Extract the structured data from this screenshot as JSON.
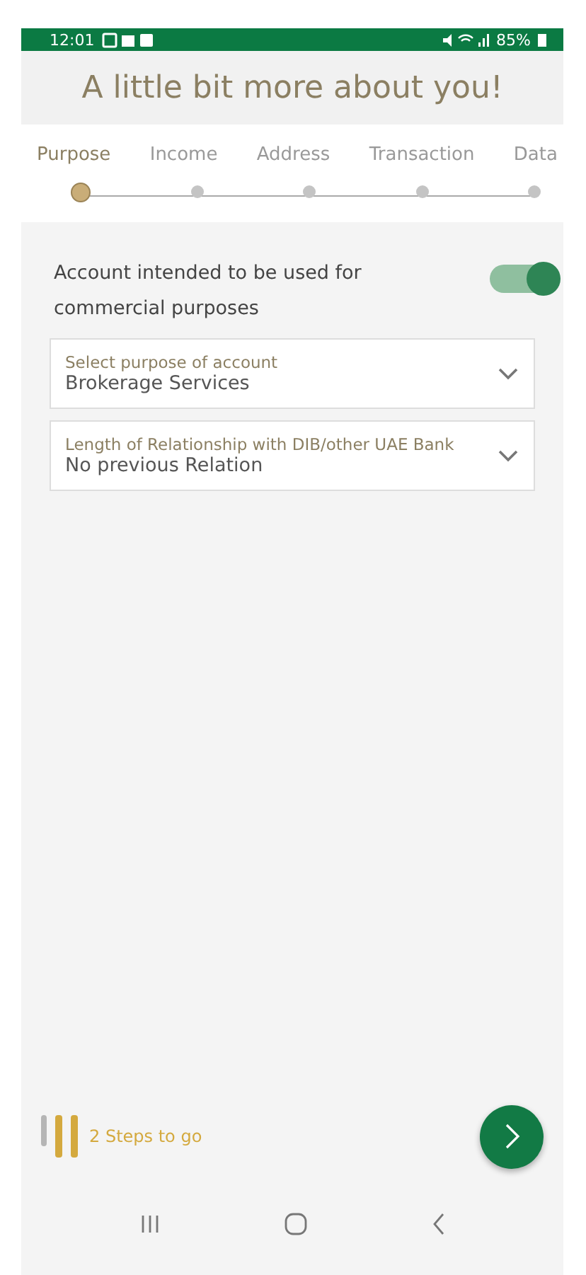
{
  "status_bar": {
    "time": "12:01",
    "battery": "85%"
  },
  "title": "A little bit more about you!",
  "steps": [
    {
      "label": "Purpose",
      "selected": true
    },
    {
      "label": "Income",
      "selected": false
    },
    {
      "label": "Address",
      "selected": false
    },
    {
      "label": "Transaction",
      "selected": false
    },
    {
      "label": "Data",
      "selected": false
    }
  ],
  "commercial_toggle": {
    "label": "Account intended to be used for commercial purposes",
    "on": true
  },
  "fields": [
    {
      "label": "Select purpose of account",
      "value": "Brokerage Services"
    },
    {
      "label": "Length of Relationship with DIB/other UAE Bank",
      "value": "No previous Relation"
    }
  ],
  "footer": {
    "progress_bars": [
      {
        "filled": false
      },
      {
        "filled": true
      },
      {
        "filled": true
      }
    ],
    "steps_left": "2 Steps to go"
  }
}
